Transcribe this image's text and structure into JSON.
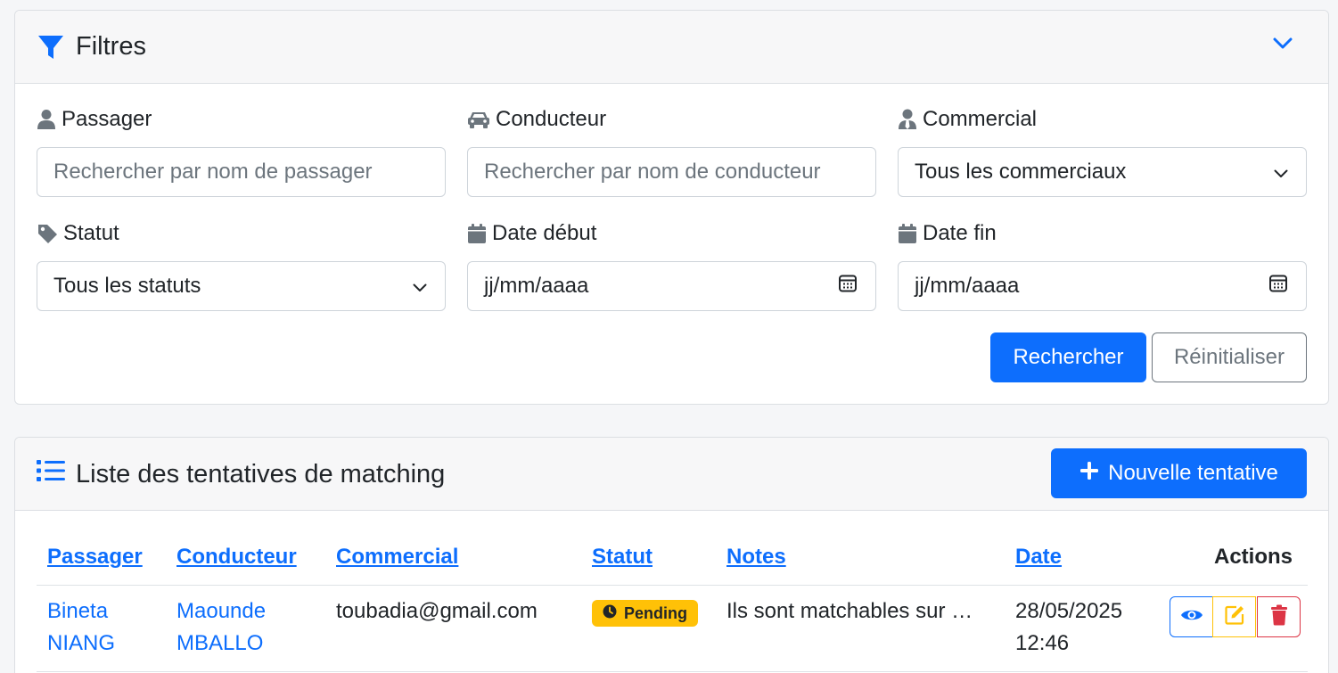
{
  "filters": {
    "title": "Filtres",
    "passager": {
      "label": "Passager",
      "placeholder": "Rechercher par nom de passager"
    },
    "conducteur": {
      "label": "Conducteur",
      "placeholder": "Rechercher par nom de conducteur"
    },
    "commercial": {
      "label": "Commercial",
      "value": "Tous les commerciaux"
    },
    "statut": {
      "label": "Statut",
      "value": "Tous les statuts"
    },
    "date_debut": {
      "label": "Date début",
      "value": "jj/mm/aaaa"
    },
    "date_fin": {
      "label": "Date fin",
      "value": "jj/mm/aaaa"
    },
    "search_button": "Rechercher",
    "reset_button": "Réinitialiser"
  },
  "list": {
    "title": "Liste des tentatives de matching",
    "new_button": "Nouvelle tentative",
    "columns": [
      "Passager",
      "Conducteur",
      "Commercial",
      "Statut",
      "Notes",
      "Date",
      "Actions"
    ],
    "rows": [
      {
        "passager_first": "Bineta",
        "passager_last": "NIANG",
        "conducteur_first": "Maounde",
        "conducteur_last": "MBALLO",
        "commercial": "toubadia@gmail.com",
        "statut": "Pending",
        "notes": "Ils sont matchables sur …",
        "date": "28/05/2025",
        "time": "12:46"
      }
    ]
  },
  "colors": {
    "primary": "#0d6efd",
    "warning": "#ffc107",
    "danger": "#dc3545",
    "secondary": "#6c757d"
  },
  "icons": [
    "filter-icon",
    "chevron-down-icon",
    "user-icon",
    "car-icon",
    "user-tie-icon",
    "tag-icon",
    "calendar-icon",
    "list-icon",
    "plus-icon",
    "clock-icon",
    "eye-icon",
    "edit-icon",
    "trash-icon"
  ]
}
